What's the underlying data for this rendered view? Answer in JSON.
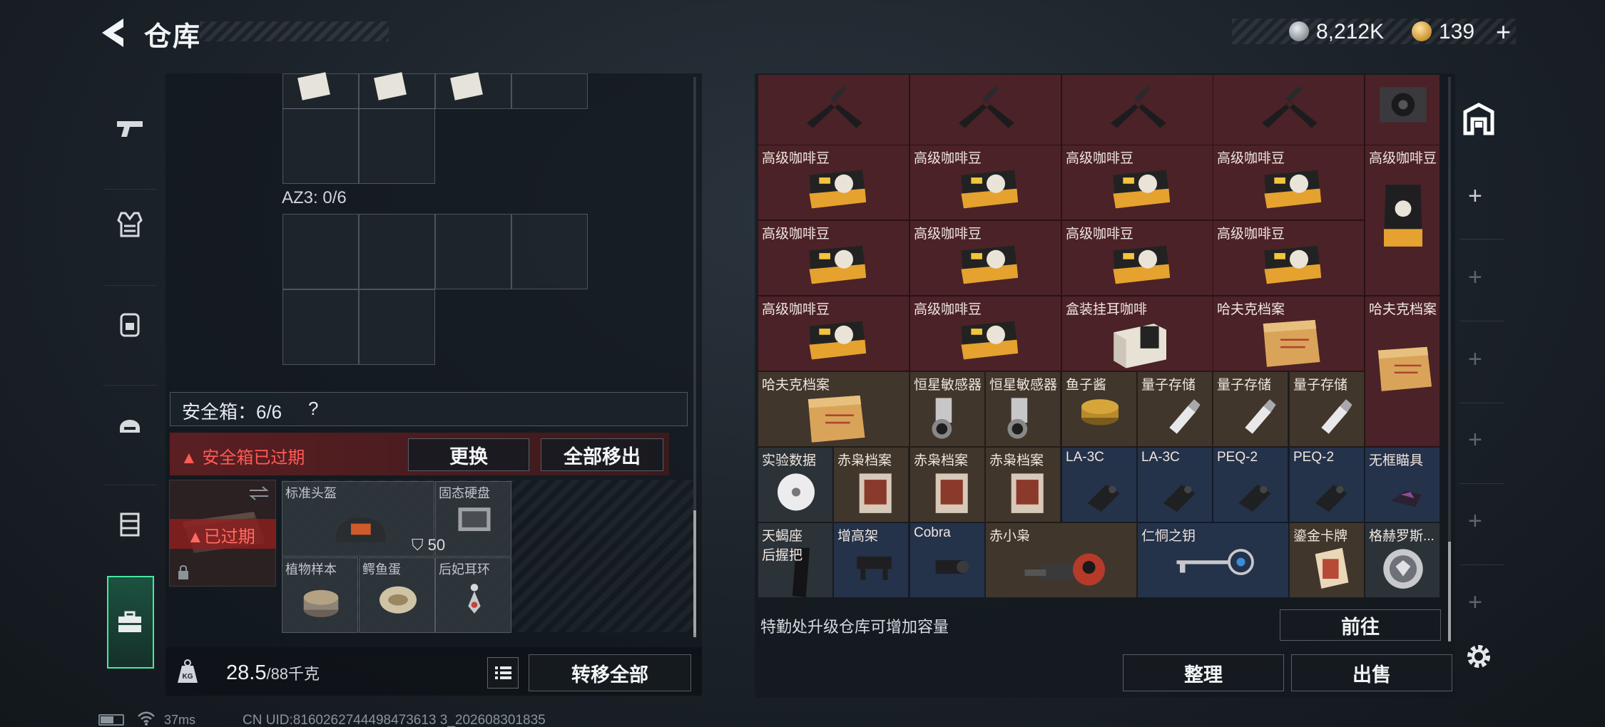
{
  "header": {
    "title": "仓库",
    "currency": {
      "silver": "8,212K",
      "gold": "139",
      "gold_plus": "+"
    }
  },
  "left": {
    "az3_label": "AZ3: 0/6",
    "safe_box": {
      "label": "安全箱：6/6",
      "help": "?",
      "expired_notice": "安全箱已过期",
      "replace_label": "更换",
      "remove_all_label": "全部移出",
      "expired_badge": "已过期",
      "items": [
        {
          "label": "标准头盔",
          "icon": "helmet-icon"
        },
        {
          "label": "固态硬盘",
          "icon": "ssd-icon"
        },
        {
          "label": "植物样本",
          "icon": "plant-sample-icon"
        },
        {
          "label": "鳄鱼蛋",
          "icon": "egg-icon"
        },
        {
          "label": "后妃耳环",
          "icon": "earring-icon"
        }
      ],
      "armor_value": "50"
    },
    "weight": {
      "current": "28.5",
      "max_unit": "/88千克"
    },
    "transfer_all_label": "转移全部"
  },
  "stash": {
    "rows": [
      {
        "cells": [
          {
            "label": "",
            "icon": "pliers-icon",
            "bg": "red"
          },
          {
            "label": "",
            "icon": "pliers-icon",
            "bg": "red"
          },
          {
            "label": "",
            "icon": "pliers-icon",
            "bg": "red"
          },
          {
            "label": "",
            "icon": "pliers-icon",
            "bg": "red"
          },
          {
            "label": "",
            "icon": "gpu-icon",
            "bg": "red"
          }
        ]
      },
      {
        "cells": [
          {
            "label": "高级咖啡豆",
            "icon": "coffee-bag-icon",
            "bg": "red"
          },
          {
            "label": "高级咖啡豆",
            "icon": "coffee-bag-icon",
            "bg": "red"
          },
          {
            "label": "高级咖啡豆",
            "icon": "coffee-bag-icon",
            "bg": "red"
          },
          {
            "label": "高级咖啡豆",
            "icon": "coffee-bag-icon",
            "bg": "red"
          },
          {
            "label": "高级咖啡豆",
            "icon": "coffee-pouch-icon",
            "bg": "red"
          }
        ]
      },
      {
        "cells": [
          {
            "label": "高级咖啡豆",
            "icon": "coffee-bag-icon",
            "bg": "red"
          },
          {
            "label": "高级咖啡豆",
            "icon": "coffee-bag-icon",
            "bg": "red"
          },
          {
            "label": "高级咖啡豆",
            "icon": "coffee-bag-icon",
            "bg": "red"
          },
          {
            "label": "高级咖啡豆",
            "icon": "coffee-bag-icon",
            "bg": "red"
          }
        ]
      },
      {
        "cells": [
          {
            "label": "高级咖啡豆",
            "icon": "coffee-bag-icon",
            "bg": "red"
          },
          {
            "label": "高级咖啡豆",
            "icon": "coffee-bag-icon",
            "bg": "red"
          },
          {
            "label": "盒装挂耳咖啡",
            "icon": "coffee-box-icon",
            "bg": "red"
          },
          {
            "label": "哈夫克档案",
            "icon": "dossier-icon",
            "bg": "red"
          },
          {
            "label": "哈夫克档案",
            "icon": "dossier-icon",
            "bg": "red"
          }
        ]
      },
      {
        "cells": [
          {
            "label": "哈夫克档案",
            "icon": "dossier-icon",
            "bg": "brown"
          },
          {
            "label": "恒星敏感器",
            "icon": "star-sensor-icon",
            "bg": "brown"
          },
          {
            "label": "恒星敏感器",
            "icon": "star-sensor-icon",
            "bg": "brown"
          },
          {
            "label": "鱼子酱",
            "icon": "caviar-icon",
            "bg": "brown"
          },
          {
            "label": "量子存储",
            "icon": "usb-drive-icon",
            "bg": "brown"
          },
          {
            "label": "量子存储",
            "icon": "usb-drive-icon",
            "bg": "brown"
          },
          {
            "label": "量子存储",
            "icon": "usb-drive-icon",
            "bg": "brown"
          }
        ]
      },
      {
        "cells": [
          {
            "label": "实验数据",
            "icon": "disc-icon",
            "bg": "gray"
          },
          {
            "label": "赤枭档案",
            "icon": "file-icon",
            "bg": "brown"
          },
          {
            "label": "赤枭档案",
            "icon": "file-icon",
            "bg": "brown"
          },
          {
            "label": "赤枭档案",
            "icon": "file-icon",
            "bg": "brown"
          },
          {
            "label": "LA-3C",
            "icon": "laser-icon",
            "bg": "blue"
          },
          {
            "label": "LA-3C",
            "icon": "laser-icon",
            "bg": "blue"
          },
          {
            "label": "PEQ-2",
            "icon": "laser-icon",
            "bg": "blue"
          },
          {
            "label": "PEQ-2",
            "icon": "laser-icon",
            "bg": "blue"
          },
          {
            "label": "无框瞄具",
            "icon": "sight-icon",
            "bg": "blue"
          }
        ]
      },
      {
        "cells": [
          {
            "label": "天蝎座\n后握把",
            "icon": "grip-icon",
            "bg": "gray"
          },
          {
            "label": "增高架",
            "icon": "riser-icon",
            "bg": "blue"
          },
          {
            "label": "Cobra",
            "icon": "scope-icon",
            "bg": "blue"
          },
          {
            "label": "赤小枭",
            "icon": "robot-icon",
            "bg": "brown"
          },
          {
            "label": "仁恫之钥",
            "icon": "key-icon",
            "bg": "blue"
          },
          {
            "label": "鎏金卡牌",
            "icon": "card-icon",
            "bg": "brown"
          },
          {
            "label": "格赫罗斯...",
            "icon": "medal-icon",
            "bg": "gray"
          }
        ]
      }
    ],
    "upgrade_text": "特勤处升级仓库可增加容量",
    "goto_label": "前往",
    "sort_label": "整理",
    "sell_label": "出售"
  },
  "status": {
    "ping": "37ms",
    "uid": "CN UID:8160262744498473613 3_202608301835"
  },
  "colors": {
    "accent": "#48e7a0",
    "expired": "#ff5a55",
    "cell_red": "#4b2227",
    "cell_brown": "#40362c",
    "cell_blue": "#24324a"
  }
}
